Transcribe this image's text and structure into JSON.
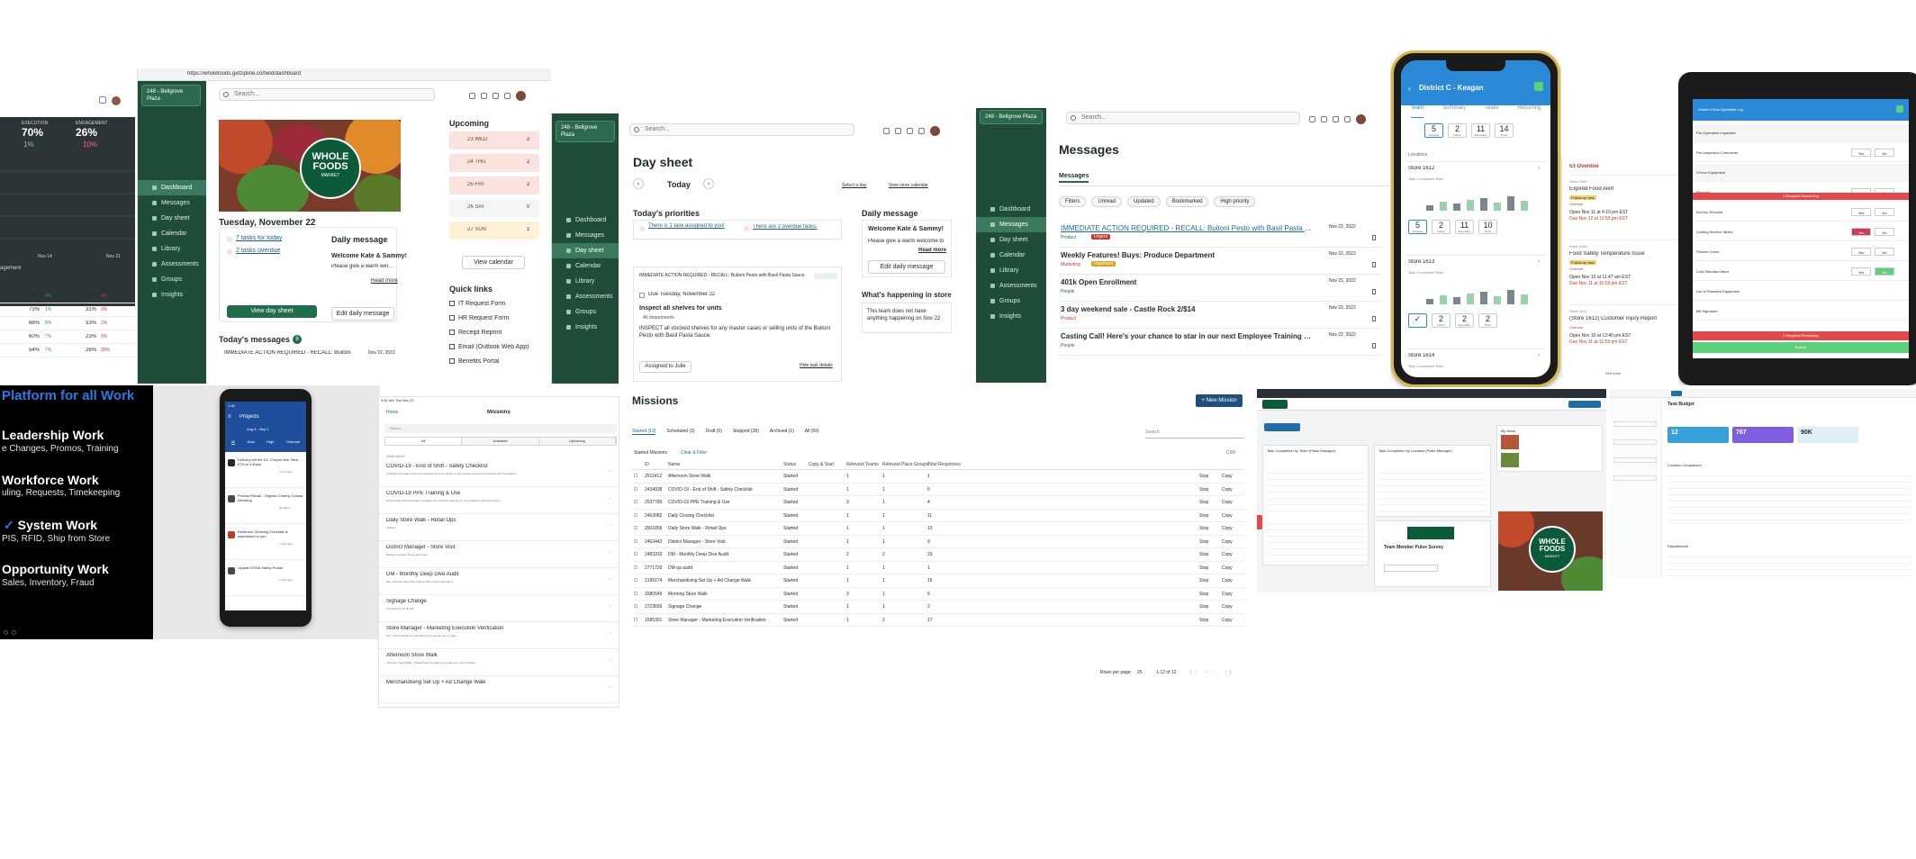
{
  "panel_analytics": {
    "kpis": [
      {
        "label": "EXECUTION",
        "value": "70%",
        "delta": "1%",
        "color": "#2e9a5a"
      },
      {
        "label": "ENGAGEMENT",
        "value": "26%",
        "delta": "10%",
        "color": "#d2334c"
      }
    ],
    "date_labels": [
      "Nov 14",
      "Nov 21"
    ],
    "section_label": "agement",
    "columns": [
      "Execution",
      "Engagement"
    ],
    "rows": [
      {
        "exec": "76%",
        "exec_delta": "4%",
        "eng": "31%",
        "eng_delta": "4%"
      },
      {
        "exec": "73%",
        "exec_delta": "1%",
        "eng": "31%",
        "eng_delta": "9%"
      },
      {
        "exec": "68%",
        "exec_delta": "8%",
        "eng": "33%",
        "eng_delta": "2%"
      },
      {
        "exec": "60%",
        "exec_delta": "7%",
        "eng": "23%",
        "eng_delta": "9%"
      },
      {
        "exec": "54%",
        "exec_delta": "7%",
        "eng": "26%",
        "eng_delta": "30%"
      }
    ]
  },
  "panel_dashboard": {
    "url": "https://wholefoods.getzipline.co/field/dashboard",
    "store": "248 - Bellgrove Plaza",
    "search_placeholder": "Search...",
    "nav": [
      "Dashboard",
      "Messages",
      "Day sheet",
      "Calendar",
      "Library",
      "Assessments",
      "Groups",
      "Insights"
    ],
    "logo_line1": "WHOLE",
    "logo_line2": "FOODS",
    "logo_line3": "MARKET",
    "date_heading": "Tuesday, November 22",
    "tasks_today": "7 tasks for today",
    "tasks_overdue": "2 tasks overdue",
    "view_day_sheet": "View day sheet",
    "daily_message_title": "Daily message",
    "daily_message_body1": "Welcome Kate & Sammy!",
    "daily_message_body2": "Please give a warm welcome to",
    "read_more": "Read more",
    "edit_daily_message": "Edit daily message",
    "todays_messages": "Today's messages",
    "todays_messages_count": "8",
    "message_preview": "IMMEDIATE ACTION REQUIRED - RECALL: Buitoni",
    "message_preview_date": "Nov 22, 2022",
    "upcoming_title": "Upcoming",
    "upcoming": [
      {
        "day": "23 WED",
        "count": "2"
      },
      {
        "day": "24 THU",
        "count": "2"
      },
      {
        "day": "25 FRI",
        "count": "2"
      },
      {
        "day": "26 SAT",
        "count": "0"
      },
      {
        "day": "27 SUN",
        "count": "1"
      }
    ],
    "view_calendar": "View calendar",
    "quick_links_title": "Quick links",
    "quick_links": [
      "IT Request Form",
      "HR Request Form",
      "Receipt Reprint",
      "Email (Outlook Web App)",
      "Benefits Portal"
    ]
  },
  "panel_daysheet": {
    "store": "248 - Bellgrove Plaza",
    "search_placeholder": "Search...",
    "nav": [
      "Dashboard",
      "Messages",
      "Day sheet",
      "Calendar",
      "Library",
      "Assessments",
      "Groups",
      "Insights"
    ],
    "title": "Day sheet",
    "today": "Today",
    "select_day": "Select a day",
    "view_store_calendar": "View store calendar",
    "priorities_title": "Today's priorities",
    "priority_1": "There is 1 task assigned to you!",
    "priority_2": "There are 2 overdue tasks.",
    "task_header": "IMMEDIATE ACTION REQUIRED - RECALL: Buitoni Pesto with Basil Pasta Sauce",
    "task_due": "Due Tuesday, November 22",
    "task_title": "Inspect all shelves for units",
    "task_meta": "All departments",
    "task_body": "INSPECT all stocked shelves for any master cases or selling units of the Buitoni Pesto with Basil Pasta Sauce.",
    "assigned": "Assigned to Julie",
    "hide_details": "Hide task details",
    "daily_message_title": "Daily message",
    "daily_message_body1": "Welcome Kate & Sammy!",
    "daily_message_body2": "Please give a warm welcome to",
    "read_more": "Read more",
    "edit_daily_message": "Edit daily message",
    "happening_title": "What's happening in store",
    "happening_body": "This team does not have anything happening on Nov 22"
  },
  "panel_messages": {
    "store": "248 - Bellgrove Plaza",
    "search_placeholder": "Search...",
    "nav": [
      "Dashboard",
      "Messages",
      "Day sheet",
      "Calendar",
      "Library",
      "Assessments",
      "Groups",
      "Insights"
    ],
    "title": "Messages",
    "tab": "Messages",
    "filters": [
      "Filters",
      "Unread",
      "Updated",
      "Bookmarked",
      "High priority"
    ],
    "messages": [
      {
        "title": "IMMEDIATE ACTION REQUIRED - RECALL: Buitoni Pesto with Basil Pasta Sauce",
        "date": "Nov 22, 2022",
        "dept": "Product",
        "tag": "Urgent",
        "tag_color": "#c0392b",
        "title_color": "#1e6aa0"
      },
      {
        "title": "Weekly Features! Buys: Produce Department",
        "date": "Nov 22, 2022",
        "dept": "Marketing",
        "tag": "Important",
        "tag_color": "#e0a21b",
        "title_color": "#1f2a2a"
      },
      {
        "title": "401k Open Enrollment",
        "date": "Nov 22, 2022",
        "dept": "People",
        "tag": "",
        "tag_color": "",
        "title_color": "#1f2a2a"
      },
      {
        "title": "3 day weekend sale - Castle Rock 2/$14",
        "date": "Nov 22, 2022",
        "dept": "Product",
        "tag": "",
        "tag_color": "",
        "title_color": "#1f2a2a"
      },
      {
        "title": "Casting Call! Here's your chance to star in our next Employee Training Video!",
        "date": "Nov 22, 2022",
        "dept": "People",
        "tag": "",
        "tag_color": "",
        "title_color": "#1f2a2a"
      }
    ]
  },
  "panel_phone_district": {
    "title": "District C - Keagan",
    "tabs": [
      "Team",
      "Summary",
      "Tasks",
      "Recurring"
    ],
    "stats_top": [
      {
        "value": "5",
        "label": "Overdue"
      },
      {
        "value": "2",
        "label": "Future"
      },
      {
        "value": "11",
        "label": "Due today"
      },
      {
        "value": "14",
        "label": "Done"
      }
    ],
    "locations_label": "Locations",
    "stores": [
      {
        "name": "Store 1612",
        "subtitle": "Task Completion Rate"
      },
      {
        "name": "Store 1613",
        "subtitle": "Task Completion Rate"
      },
      {
        "name": "Store 1614",
        "subtitle": "Task Completion Rate"
      }
    ],
    "store_stats_1": [
      {
        "value": "5",
        "label": "Overdue"
      },
      {
        "value": "2",
        "label": "Future"
      },
      {
        "value": "11",
        "label": "Due today"
      },
      {
        "value": "10",
        "label": "Done"
      }
    ],
    "store_stats_2": [
      {
        "value": "✓",
        "label": ""
      },
      {
        "value": "2",
        "label": "Future"
      },
      {
        "value": "2",
        "label": "Due today"
      },
      {
        "value": "2",
        "label": "Done"
      }
    ]
  },
  "panel_overdue": {
    "header": "53 Overdue",
    "items": [
      {
        "store": "Store 1569",
        "title": "Expired Food Alert",
        "badge": "Follow-up task",
        "status": "Overdue",
        "open": "Open Nov 11 at 4:19 pm EST",
        "due": "Due Nov 12 at 11:59 pm EST"
      },
      {
        "store": "Store 1569",
        "title": "Food Safety Temperature Issue",
        "badge": "Follow-up task",
        "status": "Overdue",
        "open": "Open Nov 10 at 11:47 am EST",
        "due": "Due Nov 11 at 11:59 pm EST"
      },
      {
        "store": "Store 1613",
        "title": "(Store 1612) Customer Injury Report",
        "badge": "",
        "status": "Overdue",
        "open": "Open Nov 10 at 12:40 pm EST",
        "due": "Due Nov 11 at 11:59 pm EST"
      }
    ],
    "see_more": "See more"
  },
  "panel_tablet": {
    "title": "Ambient Side Specialist Log",
    "rows": [
      "Pre-Operation Inspection",
      "Pre-Inspection Comments",
      "4 Hour Equipment",
      "Records",
      "Ad-Hoc Records",
      "Cooling Section Tables",
      "Freezer Cover",
      "Cold Standard Items",
      "List of Standard Equipment",
      "Bill Signature"
    ],
    "required": "1 Required Remaining",
    "yes": "Yes",
    "no": "No",
    "submit": "Submit"
  },
  "panel_black": {
    "heading": "Platform for all Work",
    "items": [
      {
        "title": "Leadership Work",
        "sub": "e Changes, Promos, Training"
      },
      {
        "title": "Workforce Work",
        "sub": "uling, Requests, Timekeeping"
      },
      {
        "title": "System Work",
        "sub": "PIS, RFID, Ship from Store"
      },
      {
        "title": "Opportunity Work",
        "sub": "Sales, Inventory, Fraud"
      }
    ]
  },
  "panel_android": {
    "time": "1:30",
    "title": "Projects",
    "date_range": "Aug 6 - Sep 6",
    "tabs": [
      "All",
      "Now",
      "High",
      "Overdue"
    ],
    "items": [
      {
        "title": "Delivery left the DC Cheyne Ave. New ETA at 4:30pm",
        "meta": "1 hour ago"
      },
      {
        "title": "Product Recall - Organic Creamy Ceasar Dressing",
        "meta": "Recalled"
      },
      {
        "title": "Restroom Cleaning Checklist is scheduled for you",
        "meta": "3 days ago"
      },
      {
        "title": "Update OSHA Safety Poster",
        "meta": "2 days ago"
      }
    ]
  },
  "panel_tablet_missions": {
    "time": "9:41 AM",
    "date": "Tue Nov 22",
    "back": "Home",
    "title": "Missions",
    "search_placeholder": "Search",
    "tabs": [
      "All",
      "Available",
      "Upcoming"
    ],
    "section": "AVAILABLE",
    "items": [
      {
        "title": "COVID-19 - End of Shift - Safety Checklist",
        "desc": "A Mission Template to ensure sanitation and compliance of appropriate Coronavirus Policies and Procedures"
      },
      {
        "title": "COVID-19 PPE Training & Use",
        "desc": "Ensure that every associate completes the refresher training on new guidelines and procedures"
      },
      {
        "title": "Daily Store Walk - Retail Ops",
        "desc": "Verifies..."
      },
      {
        "title": "District Manager - Store Visit",
        "desc": "Please complete this at each store"
      },
      {
        "title": "DM - Monthly Deep Dive Audit",
        "desc": "DM - Monthly deep dive audit by DM or Store Managers"
      },
      {
        "title": "Signage Change",
        "desc": "Complete by 10:30 AM"
      },
      {
        "title": "Store Manager - Marketing Execution Verification",
        "desc": "SM - Verify that all merchandising and signage are in place"
      },
      {
        "title": "Afternoon Store Walk",
        "desc": "Afternoon Store Walk - Please begin by taking your afternoon SD Checklist"
      },
      {
        "title": "Merchandising Set Up + Ad Change Walk",
        "desc": ""
      }
    ]
  },
  "panel_missions_table": {
    "title": "Missions",
    "new_button": "New Mission",
    "tabs": [
      "Started (13)",
      "Scheduled (3)",
      "Draft (0)",
      "Stopped (39)",
      "Archived (1)",
      "All (59)"
    ],
    "search_placeholder": "Search",
    "started_label": "Started Missions",
    "clear_filter": "Clear & Filter",
    "csv": "CSV",
    "columns": [
      "ID",
      "Name",
      "Status",
      "Copy & Start",
      "Relevant Teams",
      "Relevant Place Groups",
      "Total Responses"
    ],
    "rows": [
      {
        "id": "2511412",
        "name": "Afternoon Store Walk",
        "status": "Started",
        "teams": "1",
        "groups": "1",
        "responses": "1"
      },
      {
        "id": "2434938",
        "name": "COVID-19 - End of Shift - Safety Checklist",
        "status": "Started",
        "teams": "1",
        "groups": "1",
        "responses": "6"
      },
      {
        "id": "2537789",
        "name": "COVID-19 PPE Training & Use",
        "status": "Started",
        "teams": "3",
        "groups": "1",
        "responses": "4"
      },
      {
        "id": "2463082",
        "name": "Daily Closing Checklist",
        "status": "Started",
        "teams": "1",
        "groups": "1",
        "responses": "11"
      },
      {
        "id": "2501858",
        "name": "Daily Store Walk - Retail Ops",
        "status": "Started",
        "teams": "1",
        "groups": "1",
        "responses": "10"
      },
      {
        "id": "2463443",
        "name": "District Manager - Store Visit",
        "status": "Started",
        "teams": "1",
        "groups": "1",
        "responses": "9"
      },
      {
        "id": "2483319",
        "name": "DM - Monthly Deep Dive Audit",
        "status": "Started",
        "teams": "2",
        "groups": "2",
        "responses": "23"
      },
      {
        "id": "2771729",
        "name": "DM qa audit",
        "status": "Started",
        "teams": "1",
        "groups": "1",
        "responses": "1"
      },
      {
        "id": "2195174",
        "name": "Merchandising Set Up + Ad Change Walk",
        "status": "Started",
        "teams": "1",
        "groups": "1",
        "responses": "16"
      },
      {
        "id": "1580549",
        "name": "Morning Store Walk",
        "status": "Started",
        "teams": "3",
        "groups": "1",
        "responses": "5"
      },
      {
        "id": "2723659",
        "name": "Signage Change",
        "status": "Started",
        "teams": "1",
        "groups": "1",
        "responses": "2"
      },
      {
        "id": "1585301",
        "name": "Store Manager - Marketing Execution Verification",
        "status": "Started",
        "teams": "1",
        "groups": "2",
        "responses": "17"
      }
    ],
    "copy_label": "Copy",
    "stop_label": "Stop",
    "rows_per_page": "Rows per page:",
    "rows_per_page_value": "25",
    "pagination": "1-12 of 12"
  },
  "panel_wfm_pulse": {
    "header": "Task Completion by Team (Pulse Manager)",
    "header2": "Task Completion by Location (Pulse Manager)",
    "survey": "Team Member Pulse Survey",
    "news": "My News",
    "logo_line1": "WHOLE",
    "logo_line2": "FOODS",
    "logo_line3": "MARKET"
  },
  "panel_budget": {
    "title": "Task Budget",
    "stats": [
      {
        "value": "12",
        "color": "#3aa0d8"
      },
      {
        "value": "767",
        "color": "#7d5fe0"
      },
      {
        "value": "90K",
        "color": "#e0eef8"
      }
    ],
    "section": "Location Comparison",
    "department": "Departments"
  }
}
